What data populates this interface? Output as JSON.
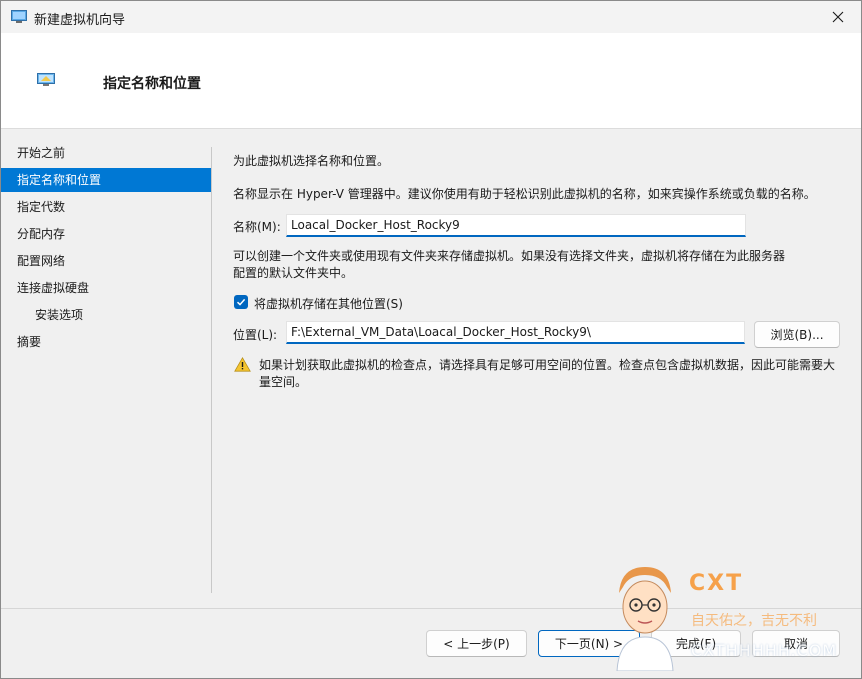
{
  "window": {
    "title": "新建虚拟机向导"
  },
  "header": {
    "title": "指定名称和位置"
  },
  "nav": {
    "items": [
      {
        "label": "开始之前",
        "active": false,
        "sub": false
      },
      {
        "label": "指定名称和位置",
        "active": true,
        "sub": false
      },
      {
        "label": "指定代数",
        "active": false,
        "sub": false
      },
      {
        "label": "分配内存",
        "active": false,
        "sub": false
      },
      {
        "label": "配置网络",
        "active": false,
        "sub": false
      },
      {
        "label": "连接虚拟硬盘",
        "active": false,
        "sub": false
      },
      {
        "label": "安装选项",
        "active": false,
        "sub": true
      },
      {
        "label": "摘要",
        "active": false,
        "sub": false
      }
    ]
  },
  "main": {
    "intro": "为此虚拟机选择名称和位置。",
    "name_hint": "名称显示在 Hyper-V 管理器中。建议你使用有助于轻松识别此虚拟机的名称，如来宾操作系统或负载的名称。",
    "name_label": "名称(M):",
    "name_value": "Loacal_Docker_Host_Rocky9",
    "folder_hint": "可以创建一个文件夹或使用现有文件夹来存储虚拟机。如果没有选择文件夹，虚拟机将存储在为此服务器配置的默认文件夹中。",
    "store_elsewhere_label": "将虚拟机存储在其他位置(S)",
    "store_elsewhere_checked": true,
    "location_label": "位置(L):",
    "location_value": "F:\\External_VM_Data\\Loacal_Docker_Host_Rocky9\\",
    "browse_label": "浏览(B)...",
    "warning": "如果计划获取此虚拟机的检查点，请选择具有足够可用空间的位置。检查点包含虚拟机数据，因此可能需要大量空间。"
  },
  "footer": {
    "prev_label": "< 上一步(P)",
    "next_label": "下一页(N) >",
    "finish_label": "完成(F)",
    "cancel_label": "取消"
  },
  "watermark": {
    "brand": "CXT",
    "slogan": "自天佑之，吉无不利",
    "domain": "CXTHHHHH.COM"
  },
  "colors": {
    "accent": "#0078d4",
    "input_underline": "#0067c0",
    "warning": "#f4c430",
    "watermark": "#f6a14a"
  }
}
